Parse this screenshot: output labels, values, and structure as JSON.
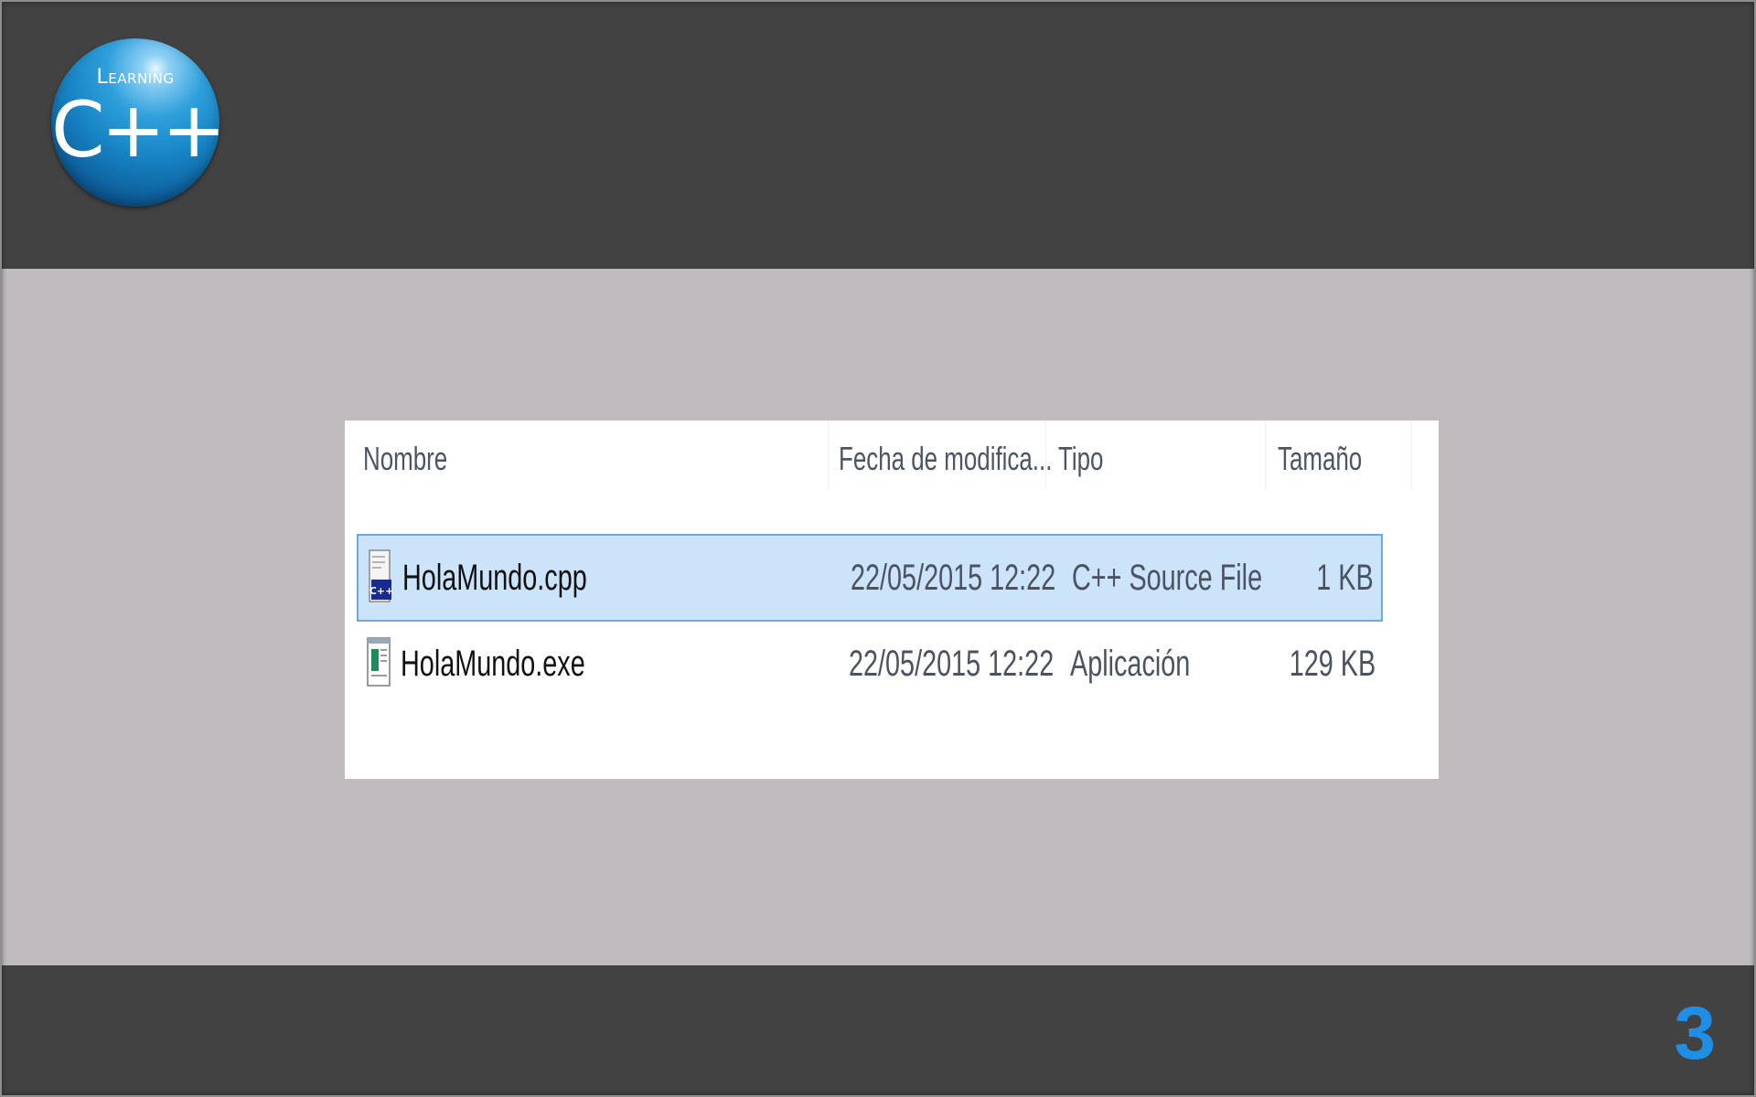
{
  "logo": {
    "word": "Learning",
    "language": "C++"
  },
  "page_number": "3",
  "explorer": {
    "columns": {
      "name": "Nombre",
      "date": "Fecha de modifica...",
      "type": "Tipo",
      "size": "Tamaño"
    },
    "files": [
      {
        "name": "HolaMundo.cpp",
        "date": "22/05/2015 12:22",
        "type": "C++ Source File",
        "size": "1 KB",
        "selected": true,
        "icon": "cpp-file-icon"
      },
      {
        "name": "HolaMundo.exe",
        "date": "22/05/2015 12:22",
        "type": "Aplicación",
        "size": "129 KB",
        "selected": false,
        "icon": "exe-file-icon"
      }
    ]
  },
  "colors": {
    "band": "#424242",
    "background": "#bfbbbf",
    "selection_fill": "#cce4f9",
    "selection_border": "#72a7d9",
    "page_number": "#1f8fe5"
  }
}
